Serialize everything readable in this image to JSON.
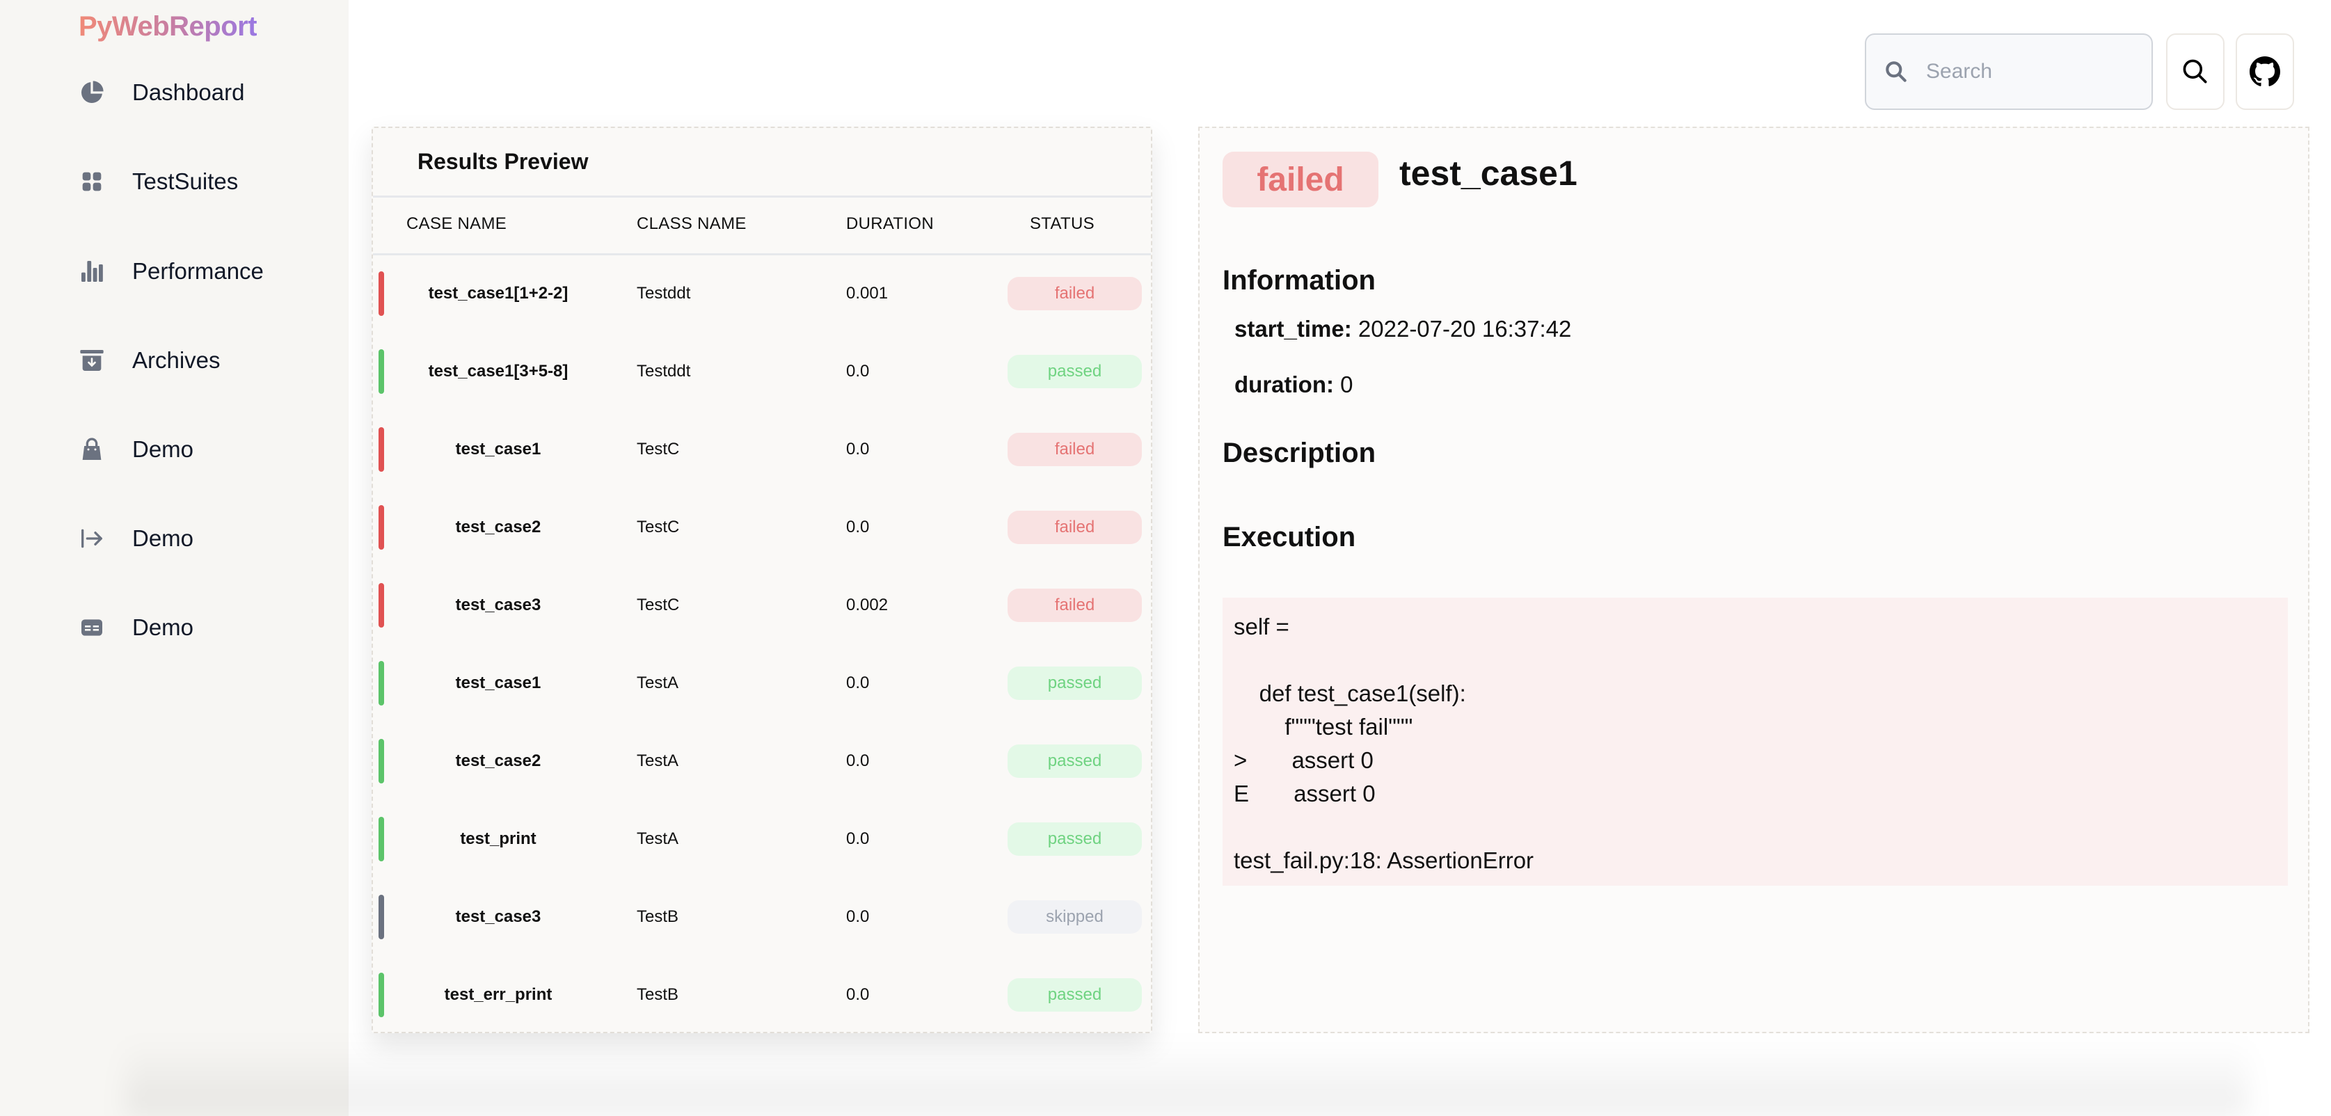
{
  "app": {
    "logo": "PyWebReport"
  },
  "sidebar": {
    "items": [
      {
        "label": "Dashboard",
        "icon": "pie-chart-icon"
      },
      {
        "label": "TestSuites",
        "icon": "grid-icon"
      },
      {
        "label": "Performance",
        "icon": "bar-chart-icon"
      },
      {
        "label": "Archives",
        "icon": "archive-icon"
      },
      {
        "label": "Demo",
        "icon": "shopping-bag-icon"
      },
      {
        "label": "Demo",
        "icon": "arrow-right-bar-icon"
      },
      {
        "label": "Demo",
        "icon": "table-icon"
      }
    ]
  },
  "header": {
    "search": {
      "placeholder": "Search",
      "value": ""
    },
    "search_button_icon": "search-icon",
    "github_button_icon": "github-icon"
  },
  "colors": {
    "failed_bar": "#e05252",
    "failed_bg": "#f9e2e2",
    "failed_text": "#e57373",
    "passed_bar": "#5cc46a",
    "passed_bg": "#e3f9e7",
    "passed_text": "#6fd381",
    "skipped_bar": "#6b7280",
    "skipped_bg": "#f1f2f5",
    "skipped_text": "#9ca3af"
  },
  "results": {
    "title": "Results Preview",
    "columns": [
      "CASE NAME",
      "CLASS NAME",
      "DURATION",
      "STATUS"
    ],
    "rows": [
      {
        "case_name": "test_case1[1+2-2]",
        "class_name": "Testddt",
        "duration": "0.001",
        "status": "failed"
      },
      {
        "case_name": "test_case1[3+5-8]",
        "class_name": "Testddt",
        "duration": "0.0",
        "status": "passed"
      },
      {
        "case_name": "test_case1",
        "class_name": "TestC",
        "duration": "0.0",
        "status": "failed"
      },
      {
        "case_name": "test_case2",
        "class_name": "TestC",
        "duration": "0.0",
        "status": "failed"
      },
      {
        "case_name": "test_case3",
        "class_name": "TestC",
        "duration": "0.002",
        "status": "failed"
      },
      {
        "case_name": "test_case1",
        "class_name": "TestA",
        "duration": "0.0",
        "status": "passed"
      },
      {
        "case_name": "test_case2",
        "class_name": "TestA",
        "duration": "0.0",
        "status": "passed"
      },
      {
        "case_name": "test_print",
        "class_name": "TestA",
        "duration": "0.0",
        "status": "passed"
      },
      {
        "case_name": "test_case3",
        "class_name": "TestB",
        "duration": "0.0",
        "status": "skipped"
      },
      {
        "case_name": "test_err_print",
        "class_name": "TestB",
        "duration": "0.0",
        "status": "passed"
      }
    ]
  },
  "detail": {
    "status": "failed",
    "title": "test_case1",
    "information_heading": "Information",
    "start_time_label": "start_time:",
    "start_time_value": "2022-07-20 16:37:42",
    "duration_label": "duration:",
    "duration_value": "0",
    "description_heading": "Description",
    "execution_heading": "Execution",
    "execution_log": "self =\n\n    def test_case1(self):\n        f\"\"\"test fail\"\"\"\n>       assert 0\nE       assert 0\n\ntest_fail.py:18: AssertionError"
  }
}
